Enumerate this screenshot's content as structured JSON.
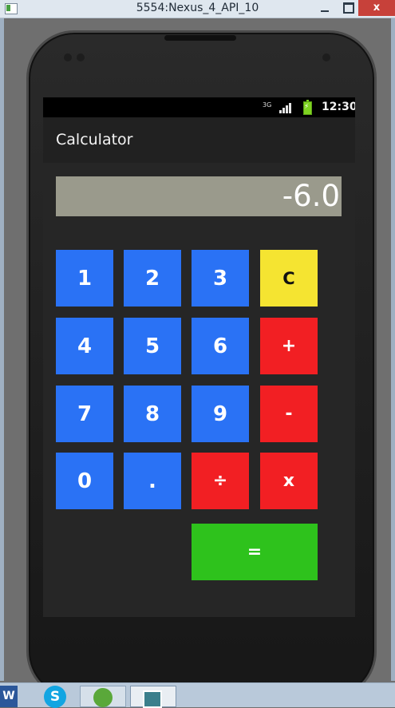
{
  "window": {
    "title": "5554:Nexus_4_API_10",
    "close_glyph": "x"
  },
  "status_bar": {
    "network_label": "3G",
    "time": "12:30"
  },
  "app": {
    "title": "Calculator"
  },
  "display": {
    "value": "-6.0"
  },
  "keys": {
    "one": "1",
    "two": "2",
    "three": "3",
    "clear": "C",
    "four": "4",
    "five": "5",
    "six": "6",
    "plus": "+",
    "seven": "7",
    "eight": "8",
    "nine": "9",
    "minus": "-",
    "zero": "0",
    "dot": ".",
    "divide": "÷",
    "multiply": "x",
    "equals": "="
  },
  "colors": {
    "number_key": "#2a72f5",
    "operator_key": "#f21f23",
    "clear_key": "#f5e431",
    "equals_key": "#2ec21c",
    "display_bg": "#9a9a8c"
  },
  "taskbar": {
    "word_label": "W",
    "skype_label": "S"
  }
}
